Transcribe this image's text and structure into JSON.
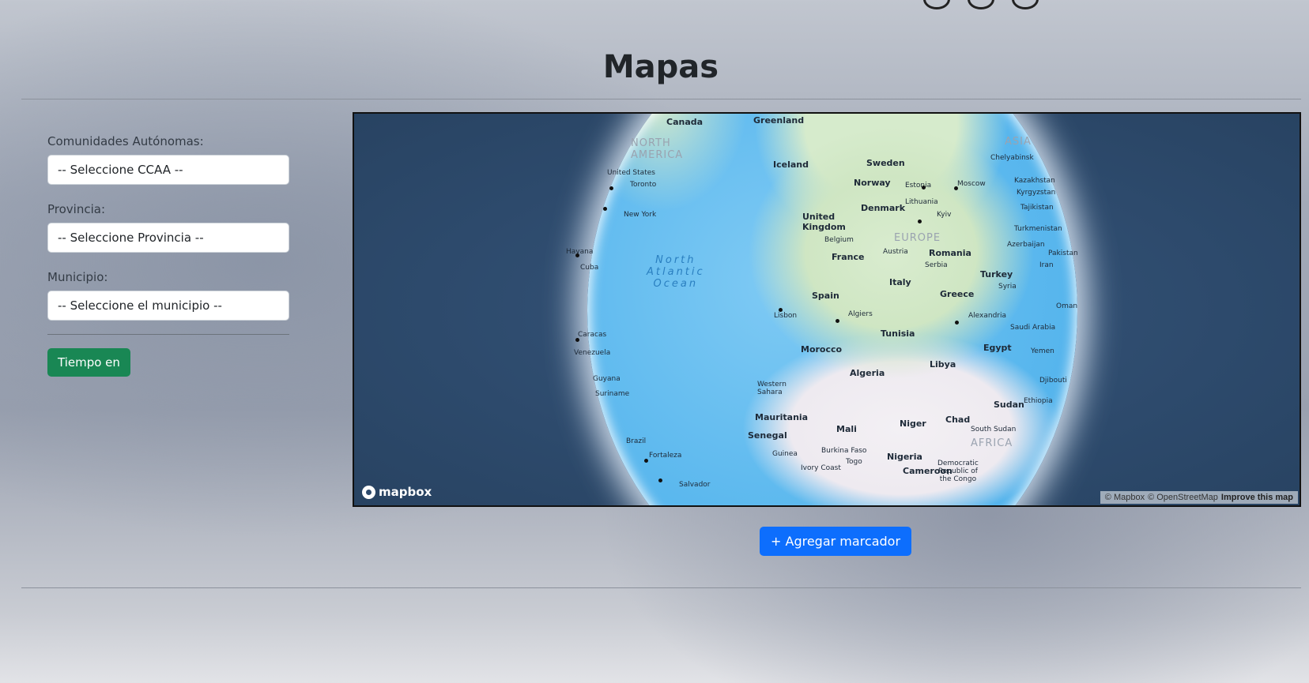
{
  "page": {
    "title": "Mapas"
  },
  "sidebar": {
    "ccaa": {
      "label": "Comunidades Autónomas:",
      "value": "-- Seleccione CCAA --"
    },
    "provincia": {
      "label": "Provincia:",
      "value": "-- Seleccione Provincia --"
    },
    "municipio": {
      "label": "Municipio:",
      "value": "-- Seleccione el municipio --"
    },
    "weather_button": "Tiempo en"
  },
  "map": {
    "provider_logo": "mapbox",
    "attribution": {
      "mapbox": "© Mapbox",
      "osm": "© OpenStreetMap",
      "improve": "Improve this map"
    },
    "labels": {
      "canada": "Canada",
      "greenland": "Greenland",
      "north_america": "NORTH\nAMERICA",
      "united_states": "United States",
      "toronto": "Toronto",
      "new_york": "New York",
      "havana": "Havana",
      "cuba": "Cuba",
      "caracas": "Caracas",
      "venezuela": "Venezuela",
      "guyana": "Guyana",
      "suriname": "Suriname",
      "brazil": "Brazil",
      "fortaleza": "Fortaleza",
      "salvador": "Salvador",
      "ocean": "North\nAtlantic\nOcean",
      "iceland": "Iceland",
      "sweden": "Sweden",
      "norway": "Norway",
      "estonia": "Estonia",
      "moscow": "Moscow",
      "chelyabinsk": "Chelyabinsk",
      "asia": "ASIA",
      "kazakhstan": "Kazakhstan",
      "kyrgyzstan": "Kyrgyzstan",
      "tajikistan": "Tajikistan",
      "turkmenistan": "Turkmenistan",
      "lithuania": "Lithuania",
      "denmark": "Denmark",
      "kyiv": "Kyiv",
      "united_kingdom": "United\nKingdom",
      "belgium": "Belgium",
      "europe": "EUROPE",
      "azerbaijan": "Azerbaijan",
      "pakistan": "Pakistan",
      "france": "France",
      "austria": "Austria",
      "romania": "Romania",
      "serbia": "Serbia",
      "iran": "Iran",
      "turkey": "Turkey",
      "italy": "Italy",
      "spain": "Spain",
      "syria": "Syria",
      "greece": "Greece",
      "lisbon": "Lisbon",
      "algiers": "Algiers",
      "oman": "Oman",
      "alexandria": "Alexandria",
      "saudi_arabia": "Saudi Arabia",
      "tunisia": "Tunisia",
      "egypt": "Egypt",
      "yemen": "Yemen",
      "morocco": "Morocco",
      "algeria": "Algeria",
      "libya": "Libya",
      "djibouti": "Djibouti",
      "western_sahara": "Western\nSahara",
      "sudan": "Sudan",
      "ethiopia": "Ethiopia",
      "mauritania": "Mauritania",
      "niger": "Niger",
      "chad": "Chad",
      "senegal": "Senegal",
      "mali": "Mali",
      "south_sudan": "South Sudan",
      "africa": "AFRICA",
      "guinea": "Guinea",
      "burkina_faso": "Burkina Faso",
      "nigeria": "Nigeria",
      "togo": "Togo",
      "ivory_coast": "Ivory Coast",
      "cameroon": "Cameroon",
      "drc": "Democratic\nRepublic of\nthe Congo"
    }
  },
  "add_marker_button": "+ Agregar marcador"
}
